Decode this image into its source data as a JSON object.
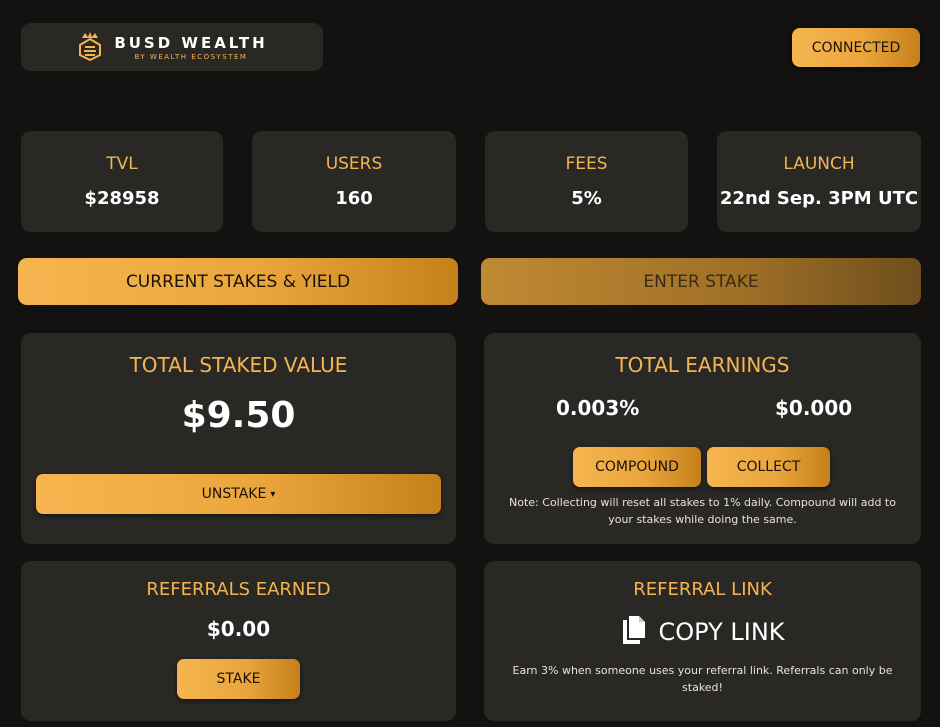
{
  "brand": {
    "title": "BUSD WEALTH",
    "subtitle": "BY WEALTH ECOSYSTEM",
    "logo_icon": "crown-bee-icon"
  },
  "header": {
    "connect_label": "CONNECTED"
  },
  "stats": [
    {
      "label": "TVL",
      "value": "$28958"
    },
    {
      "label": "USERS",
      "value": "160"
    },
    {
      "label": "FEES",
      "value": "5%"
    },
    {
      "label": "LAUNCH",
      "value": "22nd Sep. 3PM UTC"
    }
  ],
  "tabs": {
    "current": "CURRENT STAKES & YIELD",
    "enter": "ENTER STAKE"
  },
  "staked": {
    "title": "TOTAL STAKED VALUE",
    "value": "$9.50",
    "unstake_label": "UNSTAKE",
    "unstake_caret": "▾"
  },
  "earnings": {
    "title": "TOTAL EARNINGS",
    "percent": "0.003%",
    "amount": "$0.000",
    "compound_label": "COMPOUND",
    "collect_label": "COLLECT",
    "note": "Note: Collecting will reset all stakes to 1% daily. Compound will add to your stakes while doing the same."
  },
  "referrals": {
    "title": "REFERRALS EARNED",
    "value": "$0.00",
    "stake_label": "STAKE"
  },
  "ref_link": {
    "title": "REFERRAL LINK",
    "copy_label": "COPY LINK",
    "copy_icon": "copy-icon",
    "note": "Earn 3% when someone uses your referral link. Referrals can only be staked!"
  },
  "colors": {
    "background": "#141210",
    "card": "#2a2825",
    "gold": "#f3b54f",
    "gold_dark": "#c6801b"
  }
}
